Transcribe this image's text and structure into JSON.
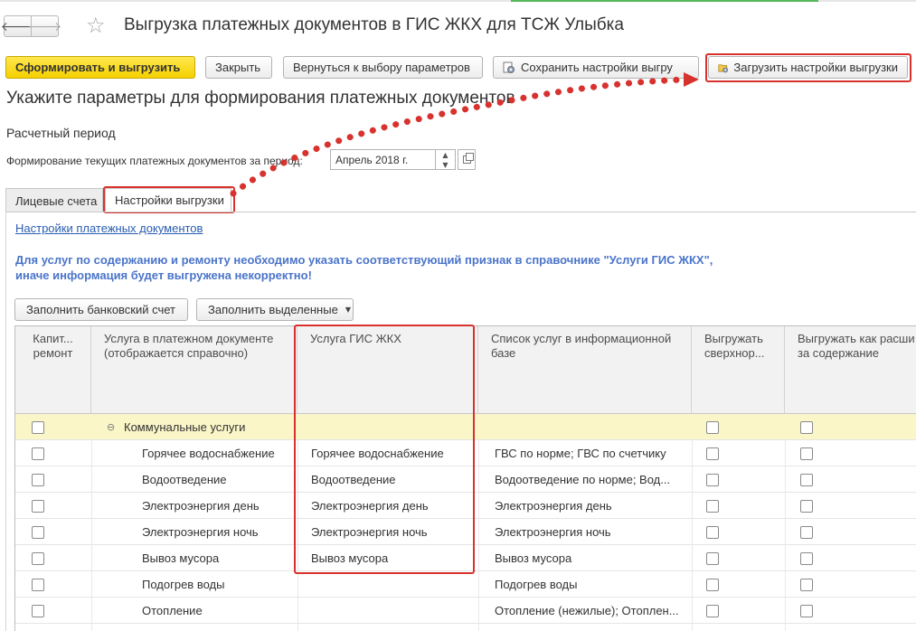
{
  "window": {
    "title": "Выгрузка платежных документов в ГИС ЖКХ для ТСЖ Улыбка",
    "back_icon": "arrow-left-icon",
    "forward_icon": "arrow-right-icon",
    "favorite_icon": "star-icon"
  },
  "toolbar": {
    "generate": "Сформировать и выгрузить",
    "close": "Закрыть",
    "back_to_params": "Вернуться к выбору параметров",
    "save_settings": "Сохранить настройки выгру",
    "load_settings": "Загрузить настройки выгрузки"
  },
  "heading": "Укажите параметры для формирования платежных документов",
  "period": {
    "section_label": "Расчетный период",
    "field_label": "Формирование текущих платежных документов за период:",
    "value": "Апрель 2018 г."
  },
  "tabs": [
    {
      "label": "Лицевые счета",
      "active": false
    },
    {
      "label": "Настройки выгрузки",
      "active": true
    }
  ],
  "settings_link": "Настройки платежных документов",
  "warning": {
    "line1": "Для услуг по содержанию и ремонту необходимо указать соответствующий признак в справочнике \"Услуги ГИС ЖКХ\",",
    "line2": "иначе информация будет выгружена некорректно!"
  },
  "table_buttons": {
    "fill_bank": "Заполнить банковский счет",
    "fill_selected": "Заполнить выделенные"
  },
  "table": {
    "columns": [
      "Капит... ремонт",
      "Услуга в платежном документе (отображается справочно)",
      "Услуга ГИС ЖКХ",
      "Список услуг в информационной базе",
      "Выгружать сверхнор...",
      "Выгружать как расши платы за содержание"
    ],
    "group": {
      "label": "Коммунальные услуги",
      "toggle": "⊖"
    },
    "rows": [
      {
        "service": "Горячее водоснабжение",
        "gis": "Горячее водоснабжение",
        "list": "ГВС по норме; ГВС по счетчику"
      },
      {
        "service": "Водоотведение",
        "gis": "Водоотведение",
        "list": "Водоотведение по норме; Вод..."
      },
      {
        "service": "Электроэнергия день",
        "gis": "Электроэнергия день",
        "list": "Электроэнергия день"
      },
      {
        "service": "Электроэнергия ночь",
        "gis": "Электроэнергия ночь",
        "list": "Электроэнергия ночь"
      },
      {
        "service": "Вывоз мусора",
        "gis": "Вывоз мусора",
        "list": "Вывоз мусора"
      },
      {
        "service": "Подогрев воды",
        "gis": "",
        "list": "Подогрев воды"
      },
      {
        "service": "Отопление",
        "gis": "",
        "list": "Отопление (нежилые); Отоплен..."
      }
    ]
  },
  "colors": {
    "primary_button": "#f5d100",
    "highlight": "#d8322e",
    "group_row": "#fbf6c8",
    "warning_text": "#4a74c9"
  }
}
